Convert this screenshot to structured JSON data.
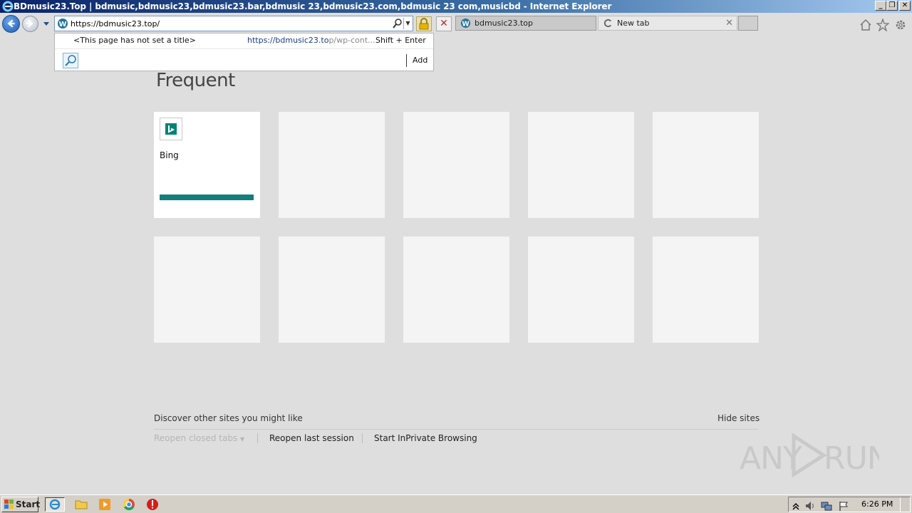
{
  "window": {
    "title": "BDmusic23.Top | bdmusic,bdmusic23,bdmusic23.bar,bdmusic 23,bdmusic23.com,bdmusic 23 com,musicbd - Internet Explorer",
    "minimize": "_",
    "restore": "❐",
    "close": "✕"
  },
  "address_bar": {
    "value": "https://bdmusic23.top/"
  },
  "dropdown": {
    "no_title": "<This page has not set a title>",
    "url_main": "https://bdmusic23.to",
    "url_dim": "p/wp-cont...",
    "shortcut": "Shift + Enter",
    "add_label": "Add"
  },
  "tabs": [
    {
      "label": "bdmusic23.top",
      "icon": "wordpress-icon"
    },
    {
      "label": "New tab",
      "icon": "loading-icon",
      "close": "✕"
    }
  ],
  "newtab_page": {
    "heading": "Frequent",
    "tiles": [
      {
        "label": "Bing",
        "icon": "bing-logo",
        "accent": "#147d7d"
      }
    ],
    "discover": "Discover other sites you might like",
    "hide_sites": "Hide sites",
    "reopen_closed_tabs": "Reopen closed tabs",
    "reopen_last_session": "Reopen last session",
    "start_inprivate": "Start InPrivate Browsing"
  },
  "watermark": "ANY RUN",
  "taskbar": {
    "start_label": "Start",
    "clock": "6:26 PM"
  }
}
